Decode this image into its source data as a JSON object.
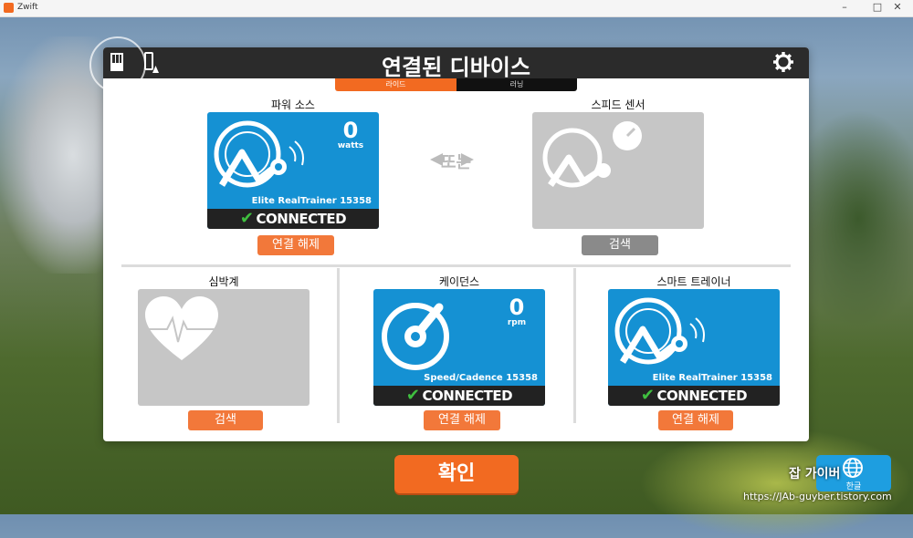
{
  "window": {
    "title": "Zwift",
    "minimize": "–",
    "maximize": "□",
    "close": "✕"
  },
  "dialog": {
    "title": "연결된 디바이스",
    "tabs": {
      "ride": "라이드",
      "run": "러닝"
    }
  },
  "power": {
    "label": "파워 소스",
    "value": "0",
    "unit": "watts",
    "device": "Elite RealTrainer 15358",
    "status": "CONNECTED",
    "button": "연결 해제"
  },
  "or_text": "또는",
  "speed": {
    "label": "스피드 센서",
    "button": "검색"
  },
  "heart": {
    "label": "심박계",
    "button": "검색"
  },
  "cadence": {
    "label": "케이던스",
    "value": "0",
    "unit": "rpm",
    "device": "Speed/Cadence 15358",
    "status": "CONNECTED",
    "button": "연결 해제"
  },
  "trainer": {
    "label": "스마트 트레이너",
    "device": "Elite RealTrainer 15358",
    "status": "CONNECTED",
    "button": "연결 해제"
  },
  "confirm": "확인",
  "language": {
    "label": "한글",
    "icon": "globe-icon"
  },
  "watermark": {
    "line1": "잡 가이버",
    "line2": "https://JAb-guyber.tistory.com"
  },
  "colors": {
    "accent": "#f26a21",
    "card_blue": "#1591d3",
    "connected_check": "#3fbf3f"
  }
}
